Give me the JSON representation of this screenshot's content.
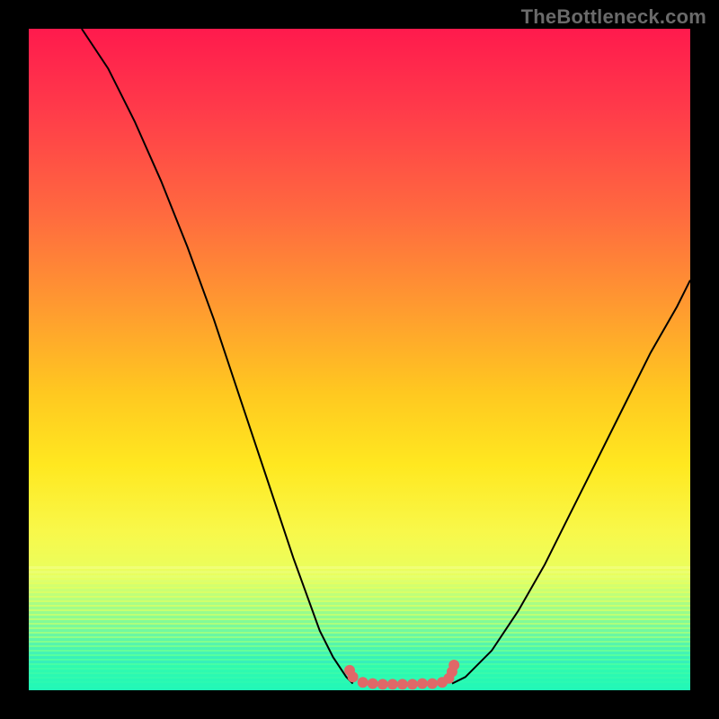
{
  "watermark": "TheBottleneck.com",
  "chart_data": {
    "type": "line",
    "title": "",
    "xlabel": "",
    "ylabel": "",
    "xlim": [
      0,
      100
    ],
    "ylim": [
      0,
      100
    ],
    "series": [
      {
        "name": "left-curve",
        "x": [
          8,
          12,
          16,
          20,
          24,
          28,
          32,
          36,
          40,
          44,
          46,
          48,
          49
        ],
        "y": [
          100,
          94,
          86,
          77,
          67,
          56,
          44,
          32,
          20,
          9,
          5,
          2,
          1
        ]
      },
      {
        "name": "right-curve",
        "x": [
          64,
          66,
          70,
          74,
          78,
          82,
          86,
          90,
          94,
          98,
          100
        ],
        "y": [
          1,
          2,
          6,
          12,
          19,
          27,
          35,
          43,
          51,
          58,
          62
        ]
      }
    ],
    "markers": {
      "name": "bottom-cluster",
      "points": [
        {
          "x": 48.5,
          "y": 3.0
        },
        {
          "x": 49.0,
          "y": 2.0
        },
        {
          "x": 50.5,
          "y": 1.2
        },
        {
          "x": 52.0,
          "y": 1.0
        },
        {
          "x": 53.5,
          "y": 0.9
        },
        {
          "x": 55.0,
          "y": 0.9
        },
        {
          "x": 56.5,
          "y": 0.9
        },
        {
          "x": 58.0,
          "y": 0.9
        },
        {
          "x": 59.5,
          "y": 1.0
        },
        {
          "x": 61.0,
          "y": 1.0
        },
        {
          "x": 62.5,
          "y": 1.2
        },
        {
          "x": 63.5,
          "y": 1.8
        },
        {
          "x": 64.0,
          "y": 2.8
        },
        {
          "x": 64.3,
          "y": 3.8
        }
      ],
      "radius": 6
    },
    "gradient_stops": [
      {
        "pos": 0,
        "color": "#ff1a4d"
      },
      {
        "pos": 12,
        "color": "#ff3a4a"
      },
      {
        "pos": 28,
        "color": "#ff6a3f"
      },
      {
        "pos": 42,
        "color": "#ff9a30"
      },
      {
        "pos": 55,
        "color": "#ffc820"
      },
      {
        "pos": 66,
        "color": "#ffe820"
      },
      {
        "pos": 76,
        "color": "#f8f84a"
      },
      {
        "pos": 83,
        "color": "#e8ff60"
      },
      {
        "pos": 88,
        "color": "#c6ff70"
      },
      {
        "pos": 92,
        "color": "#90ff88"
      },
      {
        "pos": 95,
        "color": "#50ffa0"
      },
      {
        "pos": 100,
        "color": "#20f7b8"
      }
    ]
  }
}
